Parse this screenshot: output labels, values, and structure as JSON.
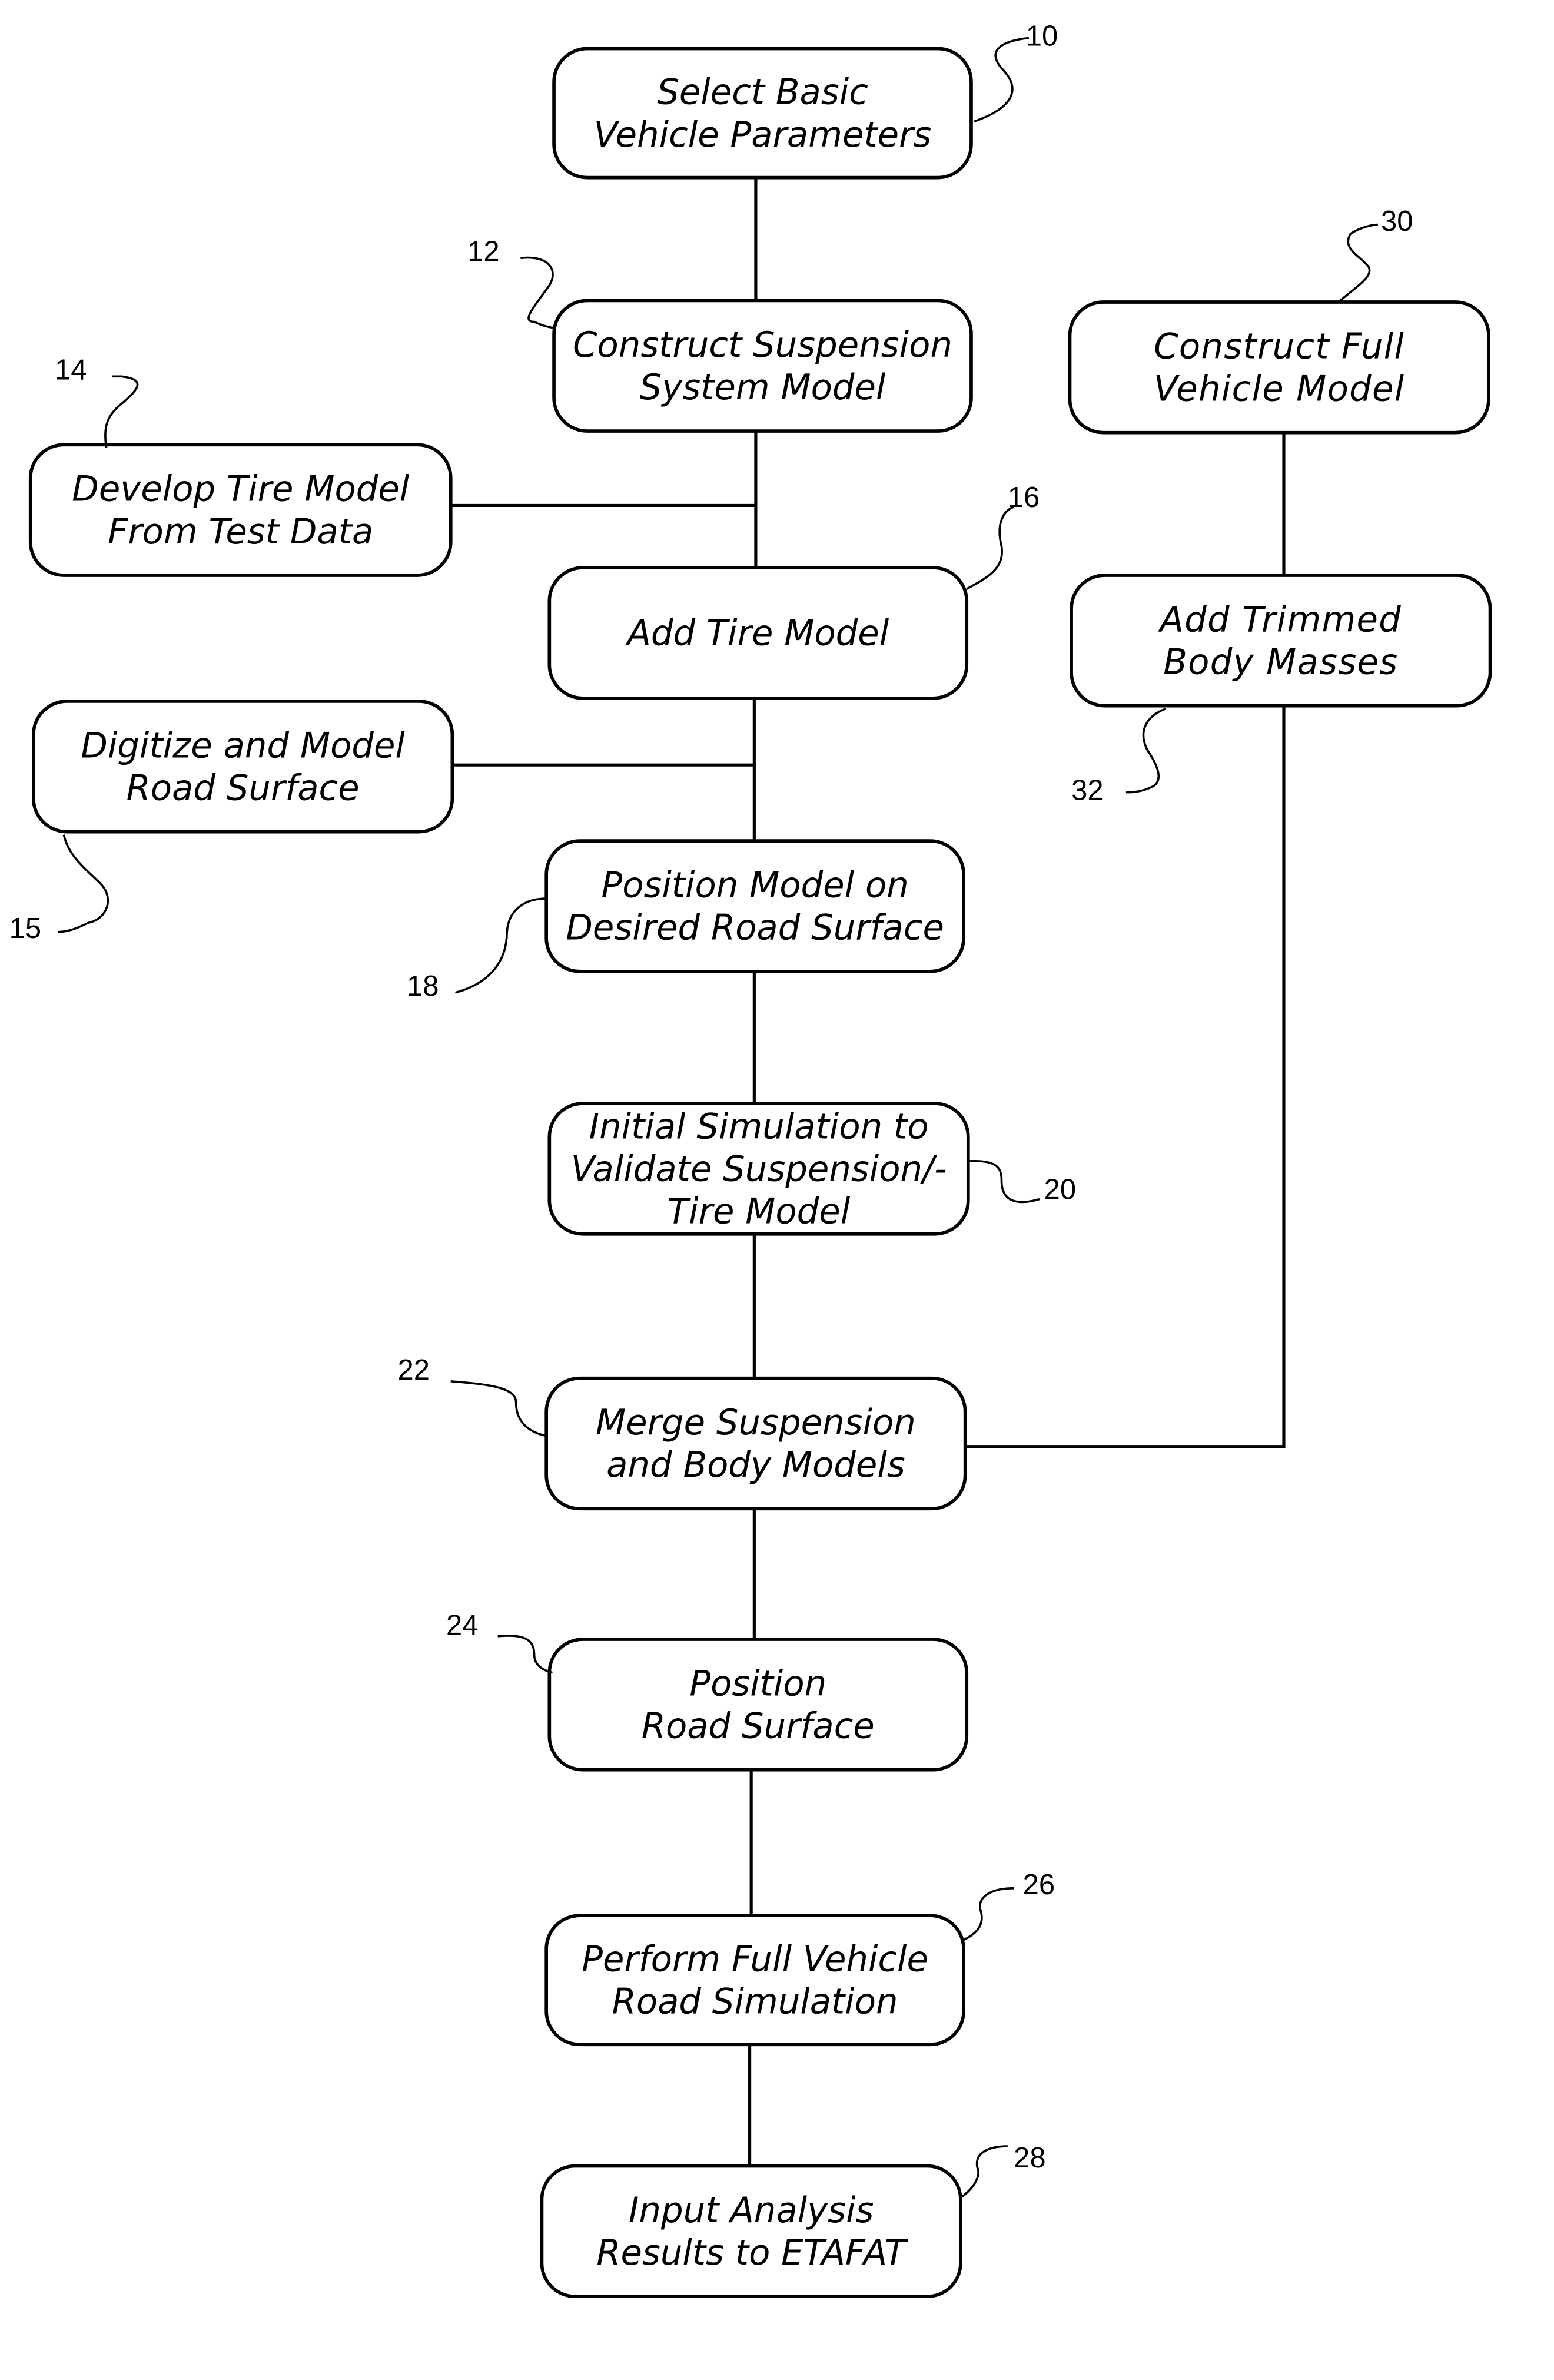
{
  "diagram": {
    "type": "flowchart",
    "steps": [
      {
        "id": "10",
        "ref": "10",
        "lines": [
          "Select Basic",
          "Vehicle Parameters"
        ]
      },
      {
        "id": "12",
        "ref": "12",
        "lines": [
          "Construct Suspension",
          "System Model"
        ]
      },
      {
        "id": "14",
        "ref": "14",
        "lines": [
          "Develop Tire Model",
          "From Test Data"
        ]
      },
      {
        "id": "16",
        "ref": "16",
        "lines": [
          "Add Tire Model"
        ]
      },
      {
        "id": "15",
        "ref": "15",
        "lines": [
          "Digitize and Model",
          "Road Surface"
        ]
      },
      {
        "id": "18",
        "ref": "18",
        "lines": [
          "Position Model on",
          "Desired Road Surface"
        ]
      },
      {
        "id": "20",
        "ref": "20",
        "lines": [
          "Initial Simulation to",
          "Validate Suspension/-",
          "Tire Model"
        ]
      },
      {
        "id": "22",
        "ref": "22",
        "lines": [
          "Merge Suspension",
          "and Body Models"
        ]
      },
      {
        "id": "24",
        "ref": "24",
        "lines": [
          "Position",
          "Road Surface"
        ]
      },
      {
        "id": "26",
        "ref": "26",
        "lines": [
          "Perform Full Vehicle",
          "Road Simulation"
        ]
      },
      {
        "id": "28",
        "ref": "28",
        "lines": [
          "Input Analysis",
          "Results to ETAFAT"
        ]
      },
      {
        "id": "30",
        "ref": "30",
        "lines": [
          "Construct Full",
          "Vehicle Model"
        ]
      },
      {
        "id": "32",
        "ref": "32",
        "lines": [
          "Add Trimmed",
          "Body Masses"
        ]
      }
    ],
    "connections": [
      [
        "10",
        "12"
      ],
      [
        "12",
        "16"
      ],
      [
        "14",
        "16"
      ],
      [
        "16",
        "18"
      ],
      [
        "15",
        "18"
      ],
      [
        "18",
        "20"
      ],
      [
        "20",
        "22"
      ],
      [
        "22",
        "24"
      ],
      [
        "24",
        "26"
      ],
      [
        "26",
        "28"
      ],
      [
        "30",
        "32"
      ],
      [
        "32",
        "22"
      ]
    ]
  }
}
